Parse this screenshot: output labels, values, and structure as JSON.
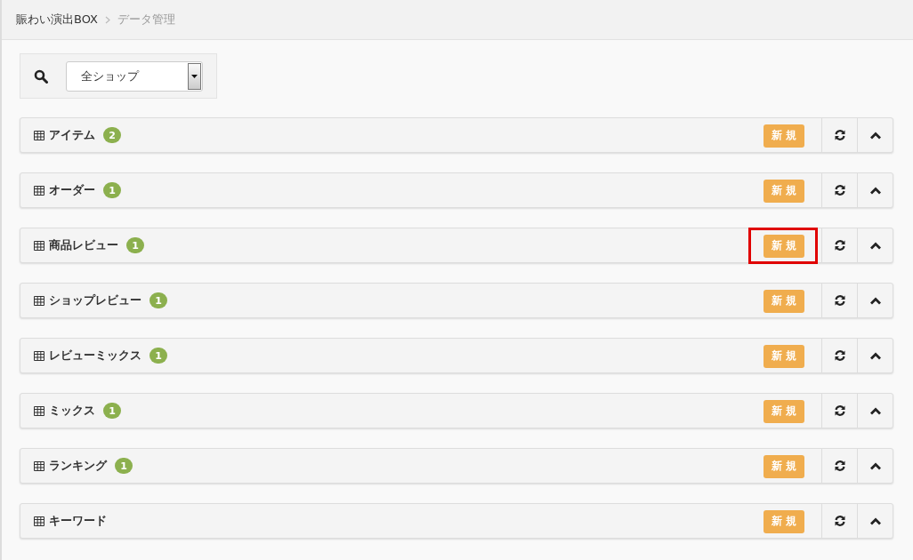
{
  "breadcrumb": [
    {
      "label": "賑わい演出BOX"
    },
    {
      "label": "データ管理"
    }
  ],
  "filter": {
    "value": "全ショップ"
  },
  "panels": [
    {
      "title": "アイテム",
      "count": "2",
      "new_label": "新 規",
      "highlighted": false
    },
    {
      "title": "オーダー",
      "count": "1",
      "new_label": "新 規",
      "highlighted": false
    },
    {
      "title": "商品レビュー",
      "count": "1",
      "new_label": "新 規",
      "highlighted": true
    },
    {
      "title": "ショップレビュー",
      "count": "1",
      "new_label": "新 規",
      "highlighted": false
    },
    {
      "title": "レビューミックス",
      "count": "1",
      "new_label": "新 規",
      "highlighted": false
    },
    {
      "title": "ミックス",
      "count": "1",
      "new_label": "新 規",
      "highlighted": false
    },
    {
      "title": "ランキング",
      "count": "1",
      "new_label": "新 規",
      "highlighted": false
    },
    {
      "title": "キーワード",
      "new_label": "新 規",
      "highlighted": false
    }
  ]
}
